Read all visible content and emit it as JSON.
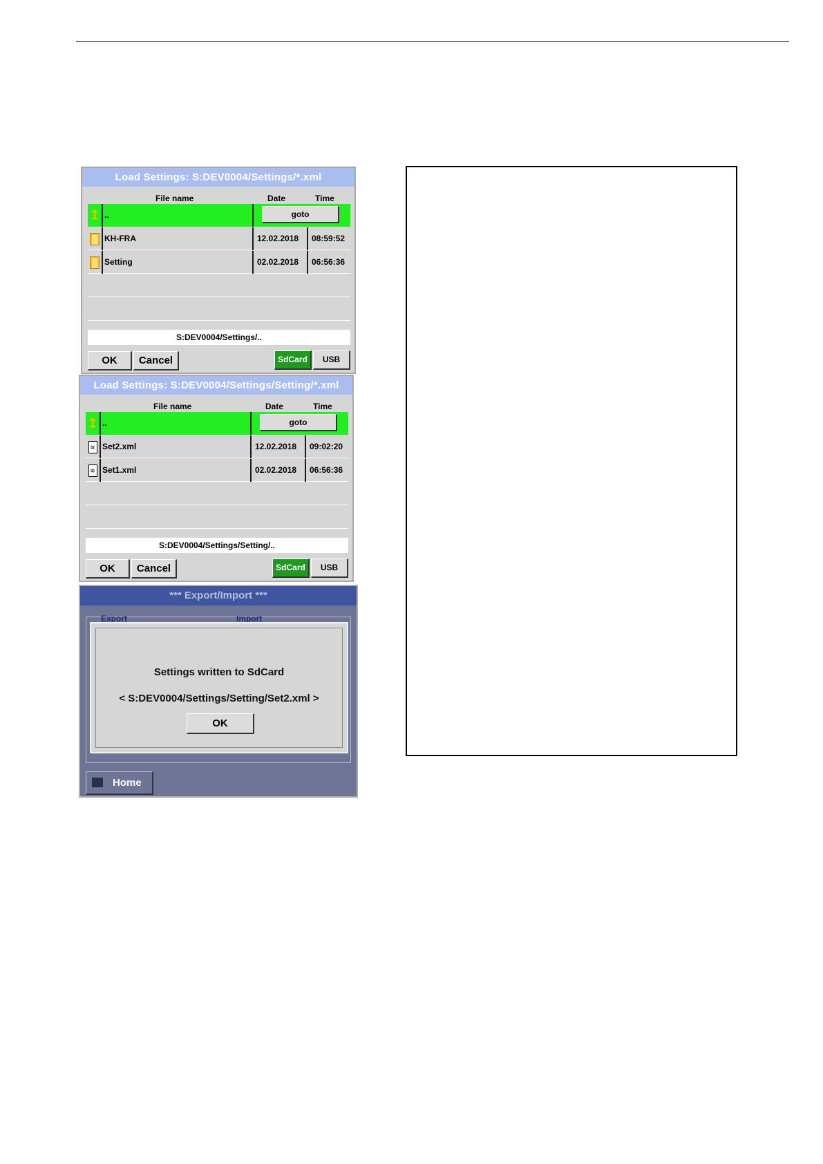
{
  "screen1": {
    "title": "Load Settings:  S:DEV0004/Settings/*.xml",
    "headers": {
      "name": "File name",
      "date": "Date",
      "time": "Time"
    },
    "rows": [
      {
        "name": "..",
        "goto": "goto"
      },
      {
        "name": "KH-FRA",
        "date": "12.02.2018",
        "time": "08:59:52"
      },
      {
        "name": "Setting",
        "date": "02.02.2018",
        "time": "06:56:36"
      }
    ],
    "path": "S:DEV0004/Settings/..",
    "buttons": {
      "ok": "OK",
      "cancel": "Cancel",
      "sdcard": "SdCard",
      "usb": "USB"
    }
  },
  "screen2": {
    "title": "Load Settings:  S:DEV0004/Settings/Setting/*.xml",
    "headers": {
      "name": "File name",
      "date": "Date",
      "time": "Time"
    },
    "rows": [
      {
        "name": "..",
        "goto": "goto"
      },
      {
        "name": "Set2.xml",
        "date": "12.02.2018",
        "time": "09:02:20"
      },
      {
        "name": "Set1.xml",
        "date": "02.02.2018",
        "time": "06:56:36"
      }
    ],
    "path": "S:DEV0004/Settings/Setting/..",
    "buttons": {
      "ok": "OK",
      "cancel": "Cancel",
      "sdcard": "SdCard",
      "usb": "USB"
    }
  },
  "screen3": {
    "title": "***  Export/Import  ***",
    "tab_export": "Export",
    "tab_import": "Import",
    "message": "Settings written to SdCard",
    "path_message": "< S:DEV0004/Settings/Setting/Set2.xml >",
    "ok": "OK",
    "home": "Home"
  },
  "colors": {
    "title_bar": "#a9bdf0",
    "selected_row": "#22ee22",
    "sdcard_button": "#1f9a1f",
    "panel_bg": "#d6d6d6",
    "export_bg": "#6e7496"
  }
}
